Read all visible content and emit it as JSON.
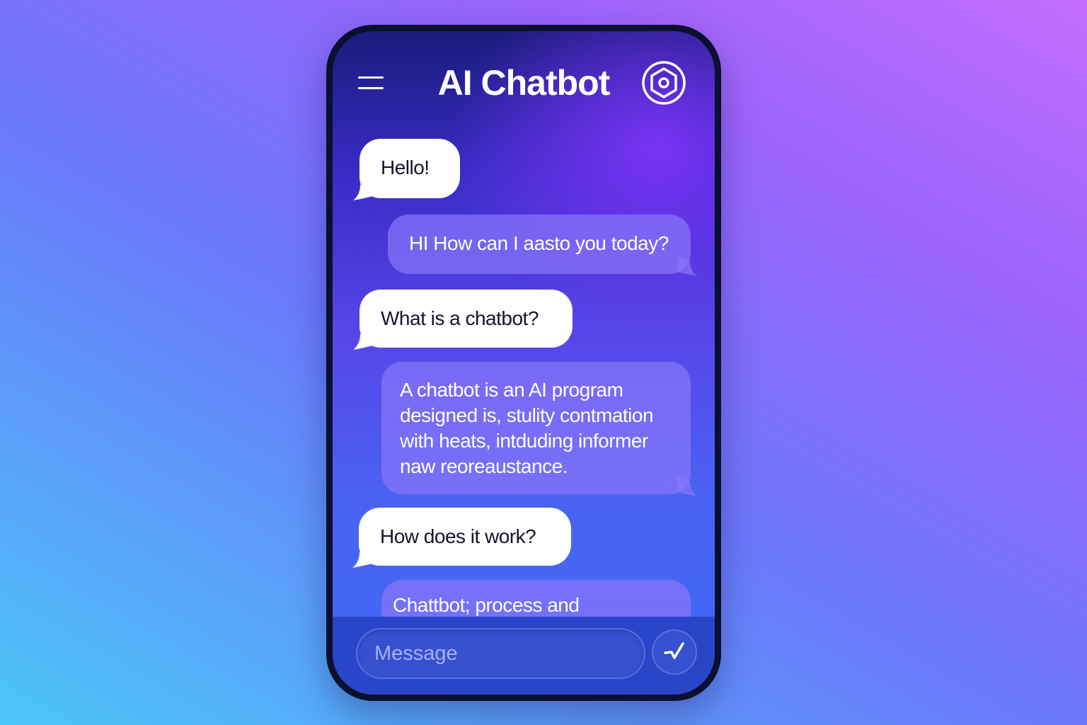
{
  "header": {
    "title": "AI Chatbot",
    "menu_icon": "hamburger-menu-icon",
    "settings_icon": "hexagon-settings-icon"
  },
  "messages": [
    {
      "sender": "user",
      "text": "Hello!"
    },
    {
      "sender": "bot",
      "text": "HI How can I aasto you today?"
    },
    {
      "sender": "user",
      "text": "What is a chatbot?"
    },
    {
      "sender": "bot",
      "lines": [
        "A chatbot is an AI program",
        "designed is, stulity contmation",
        "with heats, intduding informer",
        "naw reoreaustance."
      ]
    },
    {
      "sender": "user",
      "text": "How does it work?"
    },
    {
      "sender": "bot",
      "text": "Chattbot; process and understand"
    }
  ],
  "composer": {
    "placeholder": "Message",
    "send_icon": "send-check-icon"
  },
  "colors": {
    "background_start": "#4cc6f8",
    "background_end": "#c36dfd",
    "user_bubble": "#ffffff",
    "bot_bubble": "#8876fa",
    "screen_accent": "#7c34f8"
  }
}
